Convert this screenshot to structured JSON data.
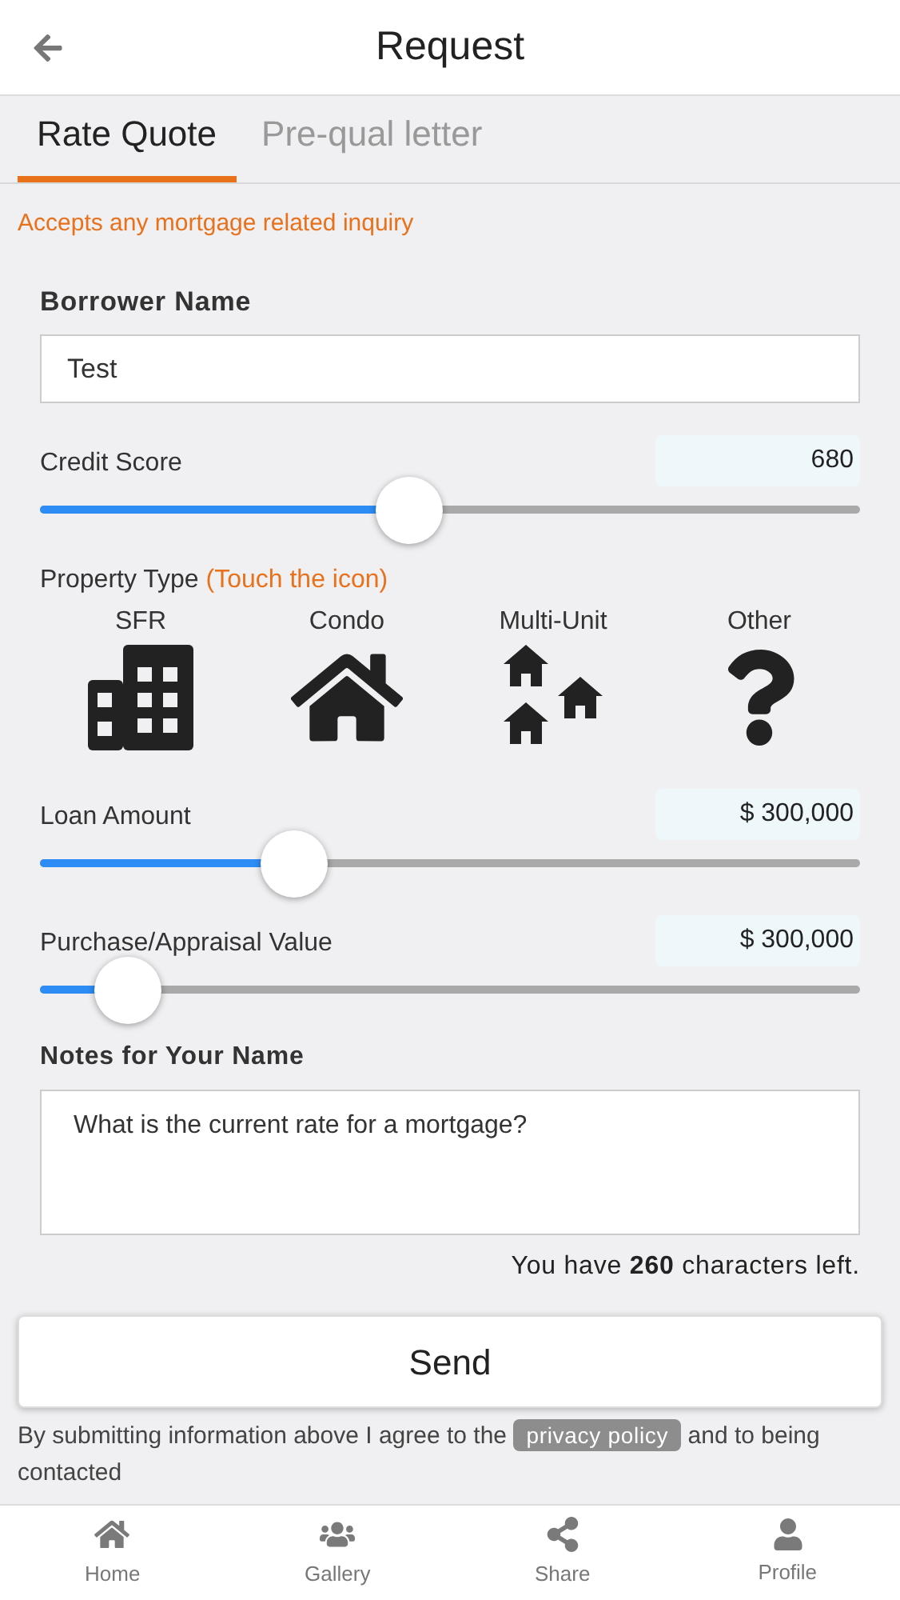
{
  "header": {
    "title": "Request"
  },
  "tabs": [
    {
      "label": "Rate Quote",
      "selected": true
    },
    {
      "label": "Pre-qual letter",
      "selected": false
    }
  ],
  "notice": "Accepts any mortgage related inquiry",
  "borrower": {
    "label": "Borrower Name",
    "value": "Test"
  },
  "credit_score": {
    "label": "Credit Score",
    "value": "680",
    "level": 0.45
  },
  "property_type": {
    "label": "Property Type",
    "hint": "(Touch the icon)",
    "options": [
      {
        "label": "SFR",
        "kind": "building"
      },
      {
        "label": "Condo",
        "kind": "house"
      },
      {
        "label": "Multi-Unit",
        "kind": "houses"
      },
      {
        "label": "Other",
        "kind": "question"
      }
    ]
  },
  "loan_amount": {
    "label": "Loan Amount",
    "value": "$ 300,000",
    "level": 0.31
  },
  "purchase_value": {
    "label": "Purchase/Appraisal Value",
    "value": "$ 300,000",
    "level": 0.108
  },
  "notes": {
    "label": "Notes for Your Name",
    "value": "What is the current rate for a mortgage?",
    "counter": "You have **260** characters left."
  },
  "send_button": "Send",
  "agreement": {
    "before": "By submitting information above I agree to the",
    "link": "privacy policy",
    "after": "and to being contacted"
  },
  "nav": [
    {
      "label": "Home",
      "kind": "home"
    },
    {
      "label": "Gallery",
      "kind": "group"
    },
    {
      "label": "Share",
      "kind": "share"
    },
    {
      "label": "Profile",
      "kind": "user"
    }
  ]
}
